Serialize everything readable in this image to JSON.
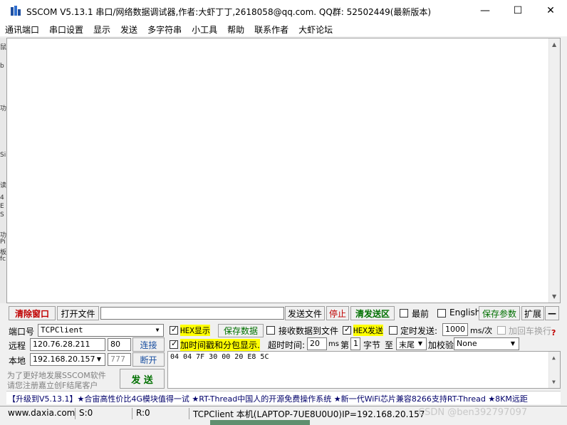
{
  "window": {
    "title": "SSCOM V5.13.1 串口/网络数据调试器,作者:大虾丁丁,2618058@qq.com. QQ群: 52502449(最新版本)",
    "minimize": "—",
    "maximize": "☐",
    "close": "✕"
  },
  "menu": [
    "通讯端口",
    "串口设置",
    "显示",
    "发送",
    "多字符串",
    "小工具",
    "帮助",
    "联系作者",
    "大虾论坛"
  ],
  "toolbar": {
    "clear_window": "清除窗口",
    "open_file": "打开文件",
    "file_path": "",
    "send_file": "发送文件",
    "stop": "停止",
    "clear_send": "清发送区",
    "topmost": "最前",
    "english": "English",
    "save_params": "保存参数",
    "expand": "扩展",
    "collapse": "—"
  },
  "port": {
    "port_label": "端口号",
    "port_value": "TCPClient",
    "remote_label": "远程",
    "remote_ip": "120.76.28.211",
    "remote_port": "80",
    "connect": "连接",
    "local_label": "本地",
    "local_ip": "192.168.20.157",
    "local_port": "777",
    "disconnect": "断开",
    "notice_line1": "为了更好地发展SSCOM软件",
    "notice_line2": "请您注册嘉立创F结尾客户",
    "send": "发  送"
  },
  "options": {
    "hex_display": "HEX显示",
    "save_data": "保存数据",
    "recv_to_file": "接收数据到文件",
    "hex_send": "HEX发送",
    "timed_send": "定时发送:",
    "interval": "1000",
    "interval_unit": "ms/次",
    "add_crlf": "加回车换行",
    "timestamp": "加时间戳和分包显示.",
    "timeout_label": "超时时间:",
    "timeout": "20",
    "timeout_unit": "ms",
    "nth": "第",
    "byte_index": "1",
    "byte_unit": "字节",
    "to": "至",
    "end": "末尾",
    "checksum_label": "加校验",
    "checksum": "None",
    "help_mark": "?"
  },
  "send_data": "04 04 7F 30 00 20 E8 5C",
  "marquee": "【升级到V5.13.1】★合宙高性价比4G模块值得一试 ★RT-Thread中国人的开源免费操作系统 ★新一代WiFi芯片兼容8266支持RT-Thread ★8KM远距",
  "status": {
    "website": "www.daxia.com",
    "sent": "S:0",
    "received": "R:0",
    "info": "TCPClient 本机(LAPTOP-7UE8U0U0)IP=192.168.20.157"
  },
  "watermark": "CSDN @ben392797097",
  "left_strip": [
    "鼠",
    "b",
    "功",
    "Si",
    "读",
    "4",
    "E",
    "S",
    "功",
    "Pi",
    "板",
    "fc"
  ]
}
